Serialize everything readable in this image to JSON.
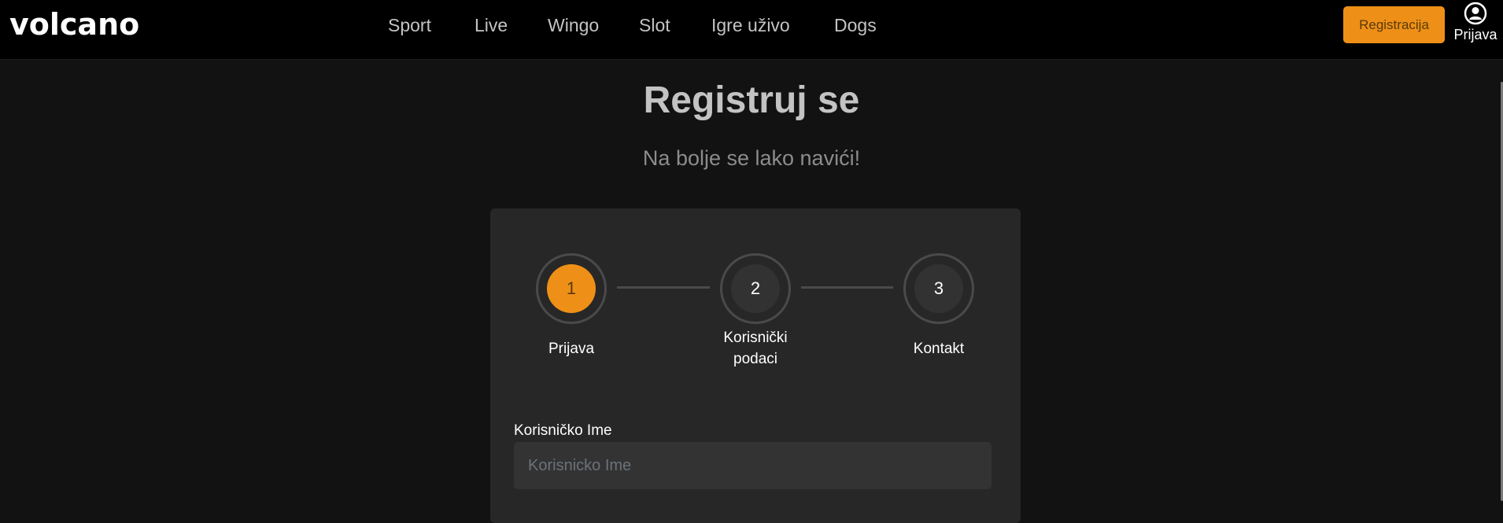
{
  "header": {
    "logo": "volcano",
    "nav": [
      "Sport",
      "Live",
      "Wingo",
      "Slot",
      "Igre uživo",
      "Dogs"
    ],
    "register_button": "Registracija",
    "login_label": "Prijava",
    "login_icon": "user-circle-icon"
  },
  "page": {
    "title": "Registruj se",
    "subtitle": "Na bolje se lako navići!"
  },
  "steps": {
    "active": 1,
    "items": [
      {
        "number": "1",
        "label": "Prijava"
      },
      {
        "number": "2",
        "label": "Korisnički podaci"
      },
      {
        "number": "3",
        "label": "Kontakt"
      }
    ]
  },
  "form": {
    "username_label": "Korisničko Ime",
    "username_placeholder": "Korisnicko Ime",
    "username_value": ""
  },
  "colors": {
    "accent": "#ee9017",
    "header_bg": "#000000",
    "page_bg": "#121212",
    "card_bg": "#272727"
  }
}
